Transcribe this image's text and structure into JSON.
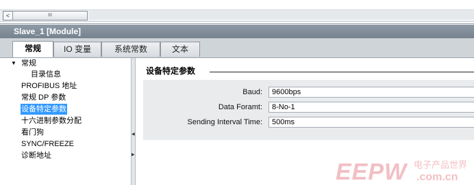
{
  "scrollbar": {
    "left_arrow": "<",
    "thumb_grip": "III"
  },
  "window": {
    "title": "Slave_1 [Module]"
  },
  "tabs": [
    {
      "label": "常规",
      "active": true
    },
    {
      "label": "IO 变量",
      "active": false
    },
    {
      "label": "系统常数",
      "active": false
    },
    {
      "label": "文本",
      "active": false
    }
  ],
  "nav": {
    "items": [
      {
        "label": "常规",
        "expanded": true
      },
      {
        "label": "目录信息"
      },
      {
        "label": "PROFIBUS 地址"
      },
      {
        "label": "常规 DP 参数"
      },
      {
        "label": "设备特定参数",
        "selected": true
      },
      {
        "label": "十六进制参数分配"
      },
      {
        "label": "看门狗"
      },
      {
        "label": "SYNC/FREEZE"
      },
      {
        "label": "诊断地址"
      }
    ]
  },
  "section": {
    "title": "设备特定参数",
    "fields": [
      {
        "label": "Baud:",
        "value": "9600bps"
      },
      {
        "label": "Data Foramt:",
        "value": "8-No-1"
      },
      {
        "label": "Sending Interval Time:",
        "value": "500ms"
      }
    ]
  },
  "watermark": {
    "brand": "EEPW",
    "cn": "电子产品世界",
    "domain": ".com.cn"
  },
  "colors": {
    "titlebar": "#76838f",
    "selection": "#3399ff",
    "field_box": "#e9ebed"
  }
}
